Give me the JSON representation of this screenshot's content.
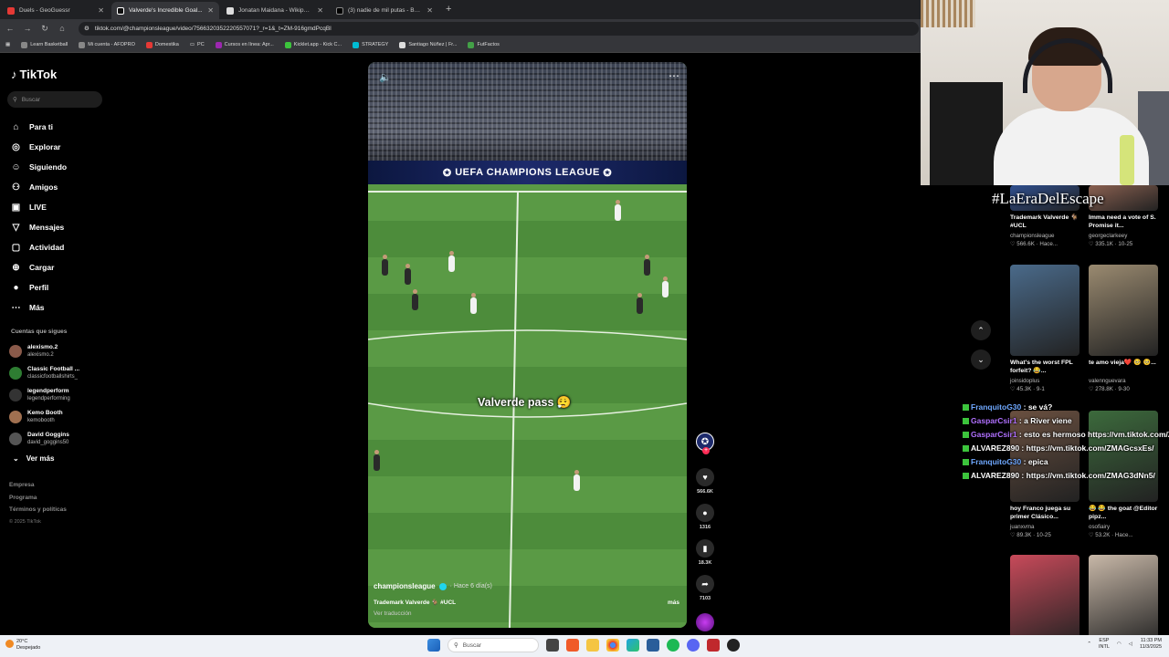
{
  "browser": {
    "tabs": [
      {
        "title": "Duels - GeoGuessr",
        "color": "#e53935"
      },
      {
        "title": "Valverde's Incredible Goal...",
        "color": "#ffffff"
      },
      {
        "title": "Jonatan Maidana - Wikipedia",
        "color": "#dddddd"
      },
      {
        "title": "(3) nadie de mil putas - Buscar",
        "color": "#000000"
      }
    ],
    "url": "tiktok.com/@championsleague/video/7566320352220557071?_r=1&_t=ZM-916gmdPcqBl",
    "bookmarks": [
      "Learn Basketball",
      "Mi cuenta - AFOPRO",
      "Domestika",
      "PC",
      "Cursos en línea: Apr...",
      "Kicklet.app - Kick C...",
      "STRATEGY",
      "Santiago Núñez | Fr...",
      "FutFactos"
    ]
  },
  "tiktok": {
    "logo": "TikTok",
    "search_placeholder": "Buscar",
    "nav": [
      {
        "label": "Para ti",
        "icon": "home-icon",
        "glyph": "⌂"
      },
      {
        "label": "Explorar",
        "icon": "compass-icon",
        "glyph": "◎"
      },
      {
        "label": "Siguiendo",
        "icon": "following-icon",
        "glyph": "☺"
      },
      {
        "label": "Amigos",
        "icon": "friends-icon",
        "glyph": "⚇"
      },
      {
        "label": "LIVE",
        "icon": "live-icon",
        "glyph": "▣"
      },
      {
        "label": "Mensajes",
        "icon": "messages-icon",
        "glyph": "▽"
      },
      {
        "label": "Actividad",
        "icon": "activity-icon",
        "glyph": "▢"
      },
      {
        "label": "Cargar",
        "icon": "upload-icon",
        "glyph": "⊕"
      },
      {
        "label": "Perfil",
        "icon": "profile-icon",
        "glyph": "●"
      },
      {
        "label": "Más",
        "icon": "more-icon",
        "glyph": "⋯"
      }
    ],
    "following_title": "Cuentas que sigues",
    "following": [
      {
        "name": "alexismo.2",
        "user": "alexismo.2",
        "color": "#8a5a4a"
      },
      {
        "name": "Classic Football ...",
        "user": "classicfootballshirts_",
        "color": "#2e7d32"
      },
      {
        "name": "legendperform",
        "user": "legendperforming",
        "color": "#333333"
      },
      {
        "name": "Kemo Booth",
        "user": "kemobooth",
        "color": "#a07050"
      },
      {
        "name": "David Goggins",
        "user": "david_goggins50",
        "color": "#555555"
      }
    ],
    "see_more": "Ver más",
    "footer": [
      "Empresa",
      "Programa",
      "Términos y políticas"
    ],
    "copyright": "© 2025 TikTok"
  },
  "video": {
    "board_text": "UEFA CHAMPIONS LEAGUE",
    "caption": "Valverde pass 😮‍💨",
    "author": "championsleague",
    "date": "· Hace 6 día(s)",
    "description": "Trademark Valverde 🐐 #UCL",
    "translate": "Ver traducción",
    "more": "más",
    "likes": "566.6K",
    "comments": "1316",
    "saves": "18.3K",
    "shares": "7103"
  },
  "recommendations": [
    {
      "title": "Trademark Valverde 🐐 #UCL",
      "user": "championsleague",
      "meta": "♡ 566.6K · Hace...",
      "color": "#2f4f8f"
    },
    {
      "title": "Imma need a vote of S. Promise it...",
      "user": "georgeclarkeey",
      "meta": "♡ 335.1K · 10-25",
      "color": "#8a6050"
    },
    {
      "title": "What's the worst FPL forfeit? 😂...",
      "user": "joinsidoplus",
      "meta": "♡ 45.3K · 9-1",
      "color": "#4a6a8a"
    },
    {
      "title": "te amo vieja❤️ 🥺 🥺...",
      "user": "valennguevara",
      "meta": "♡ 278.8K · 9-30",
      "color": "#9a8a70"
    },
    {
      "title": "hoy Franco juega su primer Clásico...",
      "user": "juanxvma",
      "meta": "♡ 89.3K · 10-25",
      "color": "#6a5040"
    },
    {
      "title": "😂 😂 the goat @Editor pipz...",
      "user": "osofiairy",
      "meta": "♡ 53.2K · Hace...",
      "color": "#3c6a3c"
    },
    {
      "title": "",
      "user": "",
      "meta": "",
      "color": "#c84a5a"
    },
    {
      "title": "",
      "user": "",
      "meta": "",
      "color": "#c8b8a8"
    }
  ],
  "chat": [
    {
      "user": "FranquitoG30",
      "msg": "se vá?",
      "style": "u"
    },
    {
      "user": "GasparCsir1",
      "msg": "a River viene",
      "style": "u2"
    },
    {
      "user": "GasparCsir1",
      "msg": "esto es hermoso https://vm.tiktok.com/ZMAGcFtJT/",
      "style": "u2"
    },
    {
      "user": "ALVAREZ890",
      "msg": "https://vm.tiktok.com/ZMAGcsxEs/",
      "style": "w"
    },
    {
      "user": "FranquitoG30",
      "msg": "epica",
      "style": "u"
    },
    {
      "user": "ALVAREZ890",
      "msg": "https://vm.tiktok.com/ZMAG3dNn5/",
      "style": "w"
    }
  ],
  "overlay_hashtag": "#LaEraDelEscape",
  "taskbar": {
    "temp": "20°C",
    "weather": "Despejado",
    "search": "Buscar",
    "lang": "ESP",
    "lang2": "INTL",
    "time": "11:33 PM",
    "date": "11/3/2025"
  }
}
